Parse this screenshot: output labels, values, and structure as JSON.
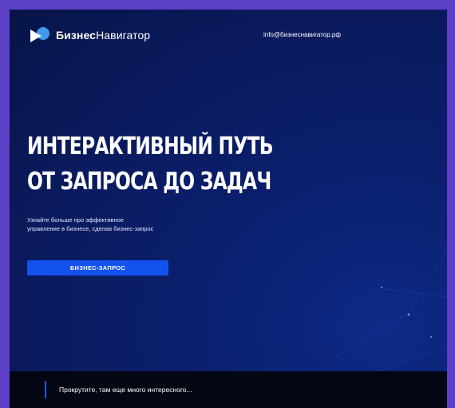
{
  "header": {
    "brand_bold": "Бизнес",
    "brand_light": "Навигатор",
    "email": "info@бизнеснавигатор.рф"
  },
  "hero": {
    "title_line1": "ИНТЕРАКТИВНЫЙ ПУТЬ",
    "title_line2": "ОТ ЗАПРОСА ДО ЗАДАЧ",
    "subtitle_line1": "Узнайте больше про эффективное",
    "subtitle_line2": "управление в бизнесе, сделав бизнес-запрос",
    "cta_label": "БИЗНЕС-ЗАПРОС"
  },
  "footer_bar": {
    "text": "Прокрутите, там еще много интересного..."
  },
  "colors": {
    "frame_border": "#5b3fc4",
    "background": "#0a1a5c",
    "accent": "#1452ee",
    "bottom_bar": "#030613"
  }
}
